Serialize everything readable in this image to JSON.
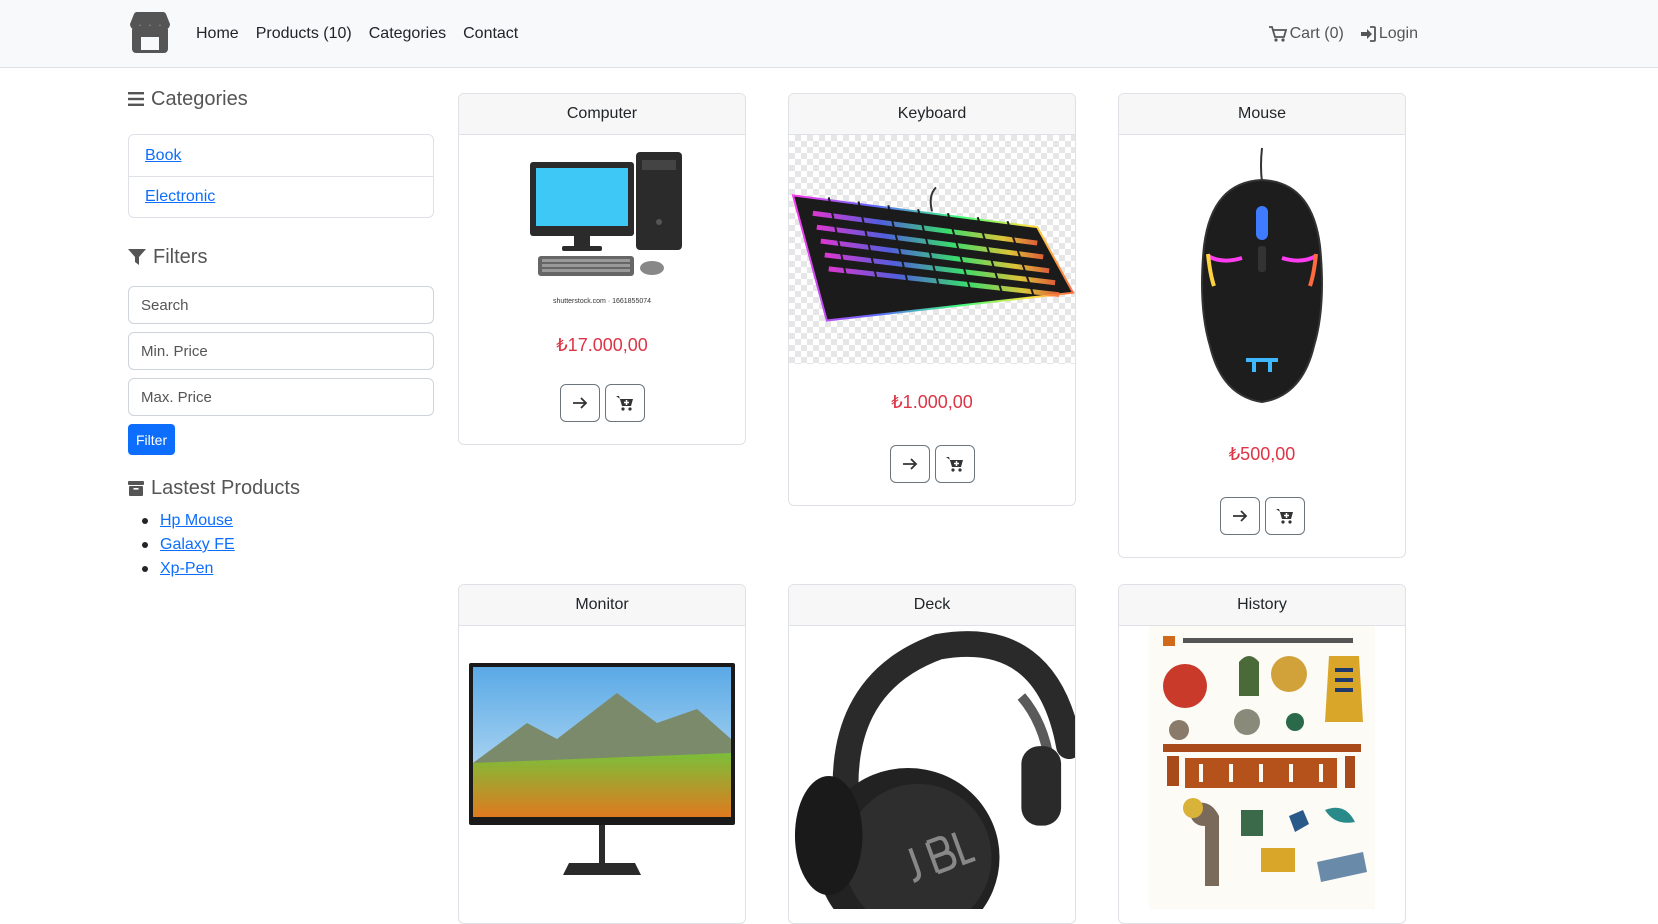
{
  "nav": {
    "brand_icon": "store-icon",
    "links": [
      "Home",
      "Products (10)",
      "Categories",
      "Contact"
    ],
    "cart": "Cart (0)",
    "login": "Login"
  },
  "sidebar": {
    "categories_heading": "Categories",
    "categories": [
      "Book",
      "Electronic"
    ],
    "filters_heading": "Filters",
    "search_placeholder": "Search",
    "min_price_placeholder": "Min. Price",
    "max_price_placeholder": "Max. Price",
    "filter_button": "Filter",
    "latest_heading": "Lastest Products",
    "latest": [
      "Hp Mouse",
      "Galaxy FE",
      "Xp-Pen"
    ]
  },
  "products": [
    {
      "name": "Computer",
      "price": "₺17.000,00",
      "image_caption": "shutterstock.com · 1661855074"
    },
    {
      "name": "Keyboard",
      "price": "₺1.000,00"
    },
    {
      "name": "Mouse",
      "price": "₺500,00"
    },
    {
      "name": "Monitor"
    },
    {
      "name": "Deck"
    },
    {
      "name": "History"
    }
  ],
  "colors": {
    "accent": "#0d6efd",
    "price": "#dc3545",
    "navbar_bg": "#f8f9fa"
  }
}
